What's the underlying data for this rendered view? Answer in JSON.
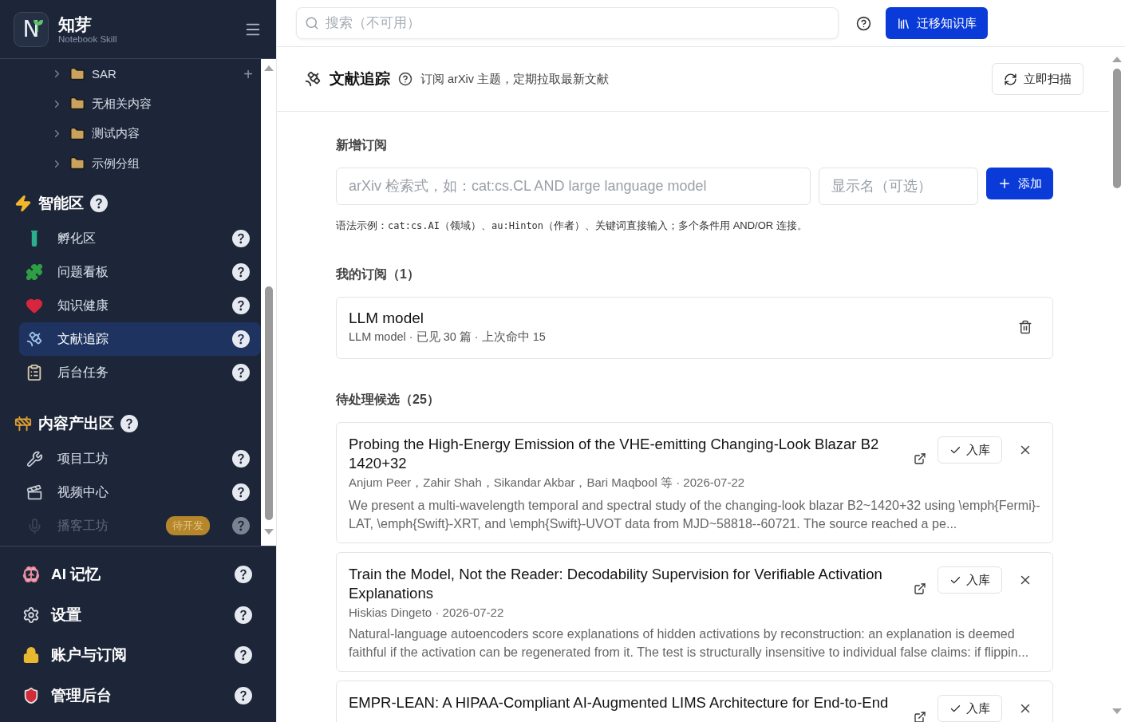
{
  "brand": {
    "logo_mark": "N",
    "name": "知芽",
    "tagline": "Notebook Skill"
  },
  "sidebar": {
    "folders": [
      {
        "label": "SAR",
        "expanded": false,
        "add": "+"
      },
      {
        "label": "无相关内容",
        "expanded": false
      },
      {
        "label": "测试内容",
        "expanded": false
      },
      {
        "label": "示例分组",
        "expanded": false
      }
    ],
    "sections": [
      {
        "title": "智能区",
        "items": [
          {
            "label": "孵化区",
            "selected": false,
            "disabled": false
          },
          {
            "label": "问题看板",
            "selected": false,
            "disabled": false
          },
          {
            "label": "知识健康",
            "selected": false,
            "disabled": false
          },
          {
            "label": "文献追踪",
            "selected": true,
            "disabled": false
          },
          {
            "label": "后台任务",
            "selected": false,
            "disabled": false
          }
        ]
      },
      {
        "title": "内容产出区",
        "items": [
          {
            "label": "项目工坊",
            "selected": false,
            "disabled": false
          },
          {
            "label": "视频中心",
            "selected": false,
            "disabled": false
          },
          {
            "label": "播客工坊",
            "selected": false,
            "disabled": true,
            "badge": "待开发"
          }
        ]
      }
    ],
    "footer_items": [
      {
        "label": "AI 记忆"
      },
      {
        "label": "设置"
      },
      {
        "label": "账户与订阅"
      },
      {
        "label": "管理后台"
      }
    ]
  },
  "topbar": {
    "search": {
      "placeholder": "搜索（不可用）"
    },
    "migrate_button": "迁移知识库"
  },
  "page": {
    "title": "文献追踪",
    "subtitle": "订阅 arXiv 主题，定期拉取最新文献",
    "scan_button": "立即扫描"
  },
  "new_subscription": {
    "heading": "新增订阅",
    "query": {
      "placeholder": "arXiv 检索式，如：cat:cs.CL AND large language model"
    },
    "display_name": {
      "placeholder": "显示名（可选）"
    },
    "add_button": "添加",
    "hint": [
      {
        "kind": "plain",
        "text": "语法示例："
      },
      {
        "kind": "code",
        "text": "cat:cs.AI"
      },
      {
        "kind": "plain",
        "text": "（领域）、"
      },
      {
        "kind": "code",
        "text": "au:Hinton"
      },
      {
        "kind": "plain",
        "text": "（作者）、关键词直接输入；多个条件用 AND/OR 连接。"
      }
    ]
  },
  "subscriptions": {
    "heading": "我的订阅（1）",
    "items": [
      {
        "name": "LLM model",
        "meta": "LLM model · 已见 30 篇 · 上次命中 15"
      }
    ]
  },
  "candidates": {
    "heading": "待处理候选（25）",
    "items": [
      {
        "title": "Probing the High-Energy Emission of the VHE-emitting Changing-Look Blazar B2 1420+32",
        "authors": "Anjum Peer，Zahir Shah，Sikandar Akbar，Bari Maqbool 等 · 2026-07-22",
        "abstract": "We present a multi-wavelength temporal and spectral study of the changing-look blazar B2~1420+32 using \\emph{Fermi}-LAT, \\emph{Swift}-XRT, and \\emph{Swift}-UVOT data from MJD~58818--60721. The source reached a pe...",
        "accept_button": "入库"
      },
      {
        "title": "Train the Model, Not the Reader: Decodability Supervision for Verifiable Activation Explanations",
        "authors": "Hiskias Dingeto · 2026-07-22",
        "abstract": "Natural-language autoencoders score explanations of hidden activations by reconstruction: an explanation is deemed faithful if the activation can be regenerated from it. The test is structurally insensitive to individual false claims: if flippin...",
        "accept_button": "入库"
      },
      {
        "title": "EMPR-LEAN: A HIPAA-Compliant AI-Augmented LIMS Architecture for End-to-End",
        "accept_button": "入库"
      }
    ]
  }
}
